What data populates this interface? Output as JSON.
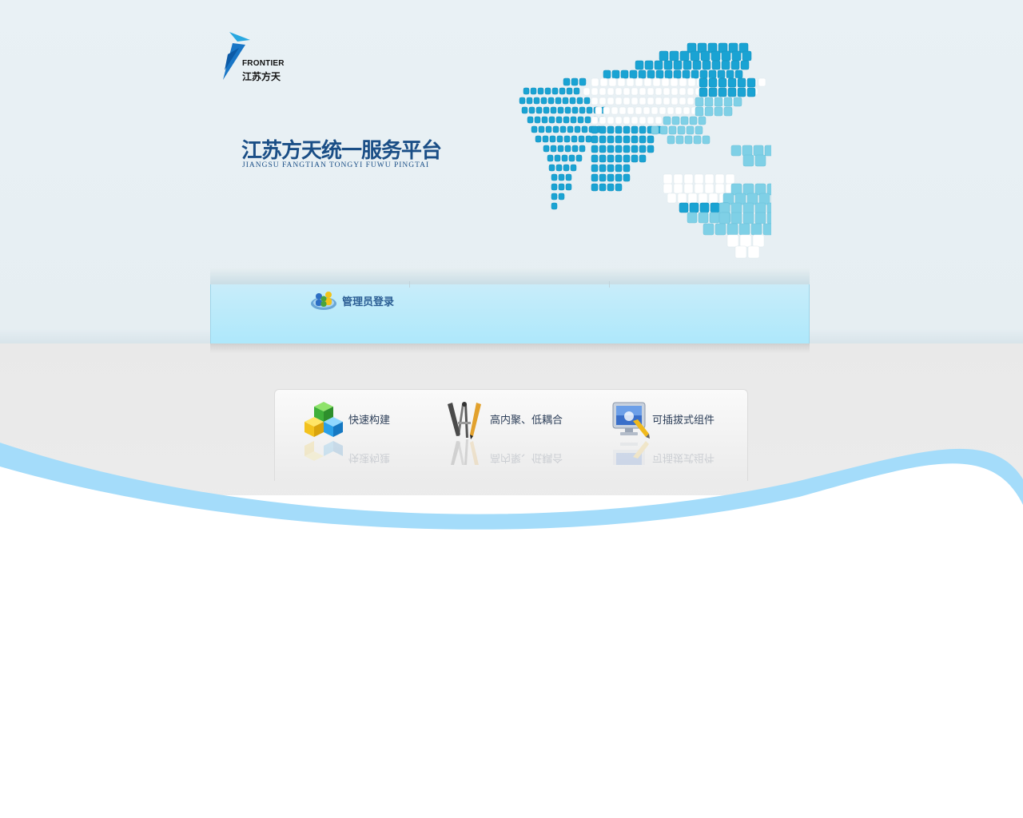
{
  "brand": {
    "logo_en": "FRONTIER",
    "logo_cn": "江苏方天",
    "title_cn": "江苏方天统一服务平台",
    "title_en": "JIANGSU FANGTIAN TONGYI  FUWU PINGTAI"
  },
  "login": {
    "admin_label": "管理员登录"
  },
  "features": [
    {
      "label": "快速构建",
      "icon": "building-blocks-icon"
    },
    {
      "label": "高内聚、低耦合",
      "icon": "drafting-tools-icon"
    },
    {
      "label": "可插拔式组件",
      "icon": "monitor-plugin-icon"
    }
  ],
  "colors": {
    "brand_blue": "#1a4e86",
    "accent_light_blue": "#aee8fb",
    "wave_blue": "#a4dcfa"
  }
}
